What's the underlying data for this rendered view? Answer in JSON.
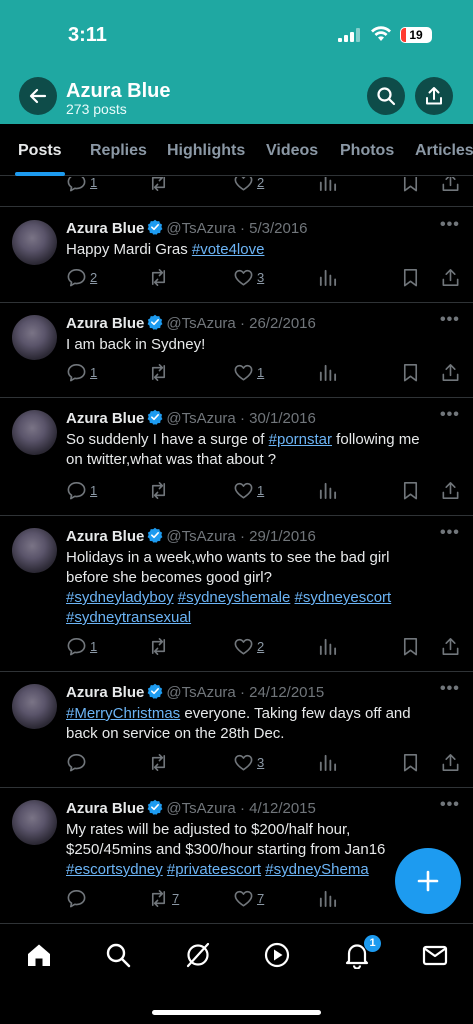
{
  "status_bar": {
    "time": "3:11",
    "battery": "19"
  },
  "header": {
    "name": "Azura Blue",
    "post_count": "273 posts"
  },
  "tabs": [
    {
      "label": "Posts",
      "active": true
    },
    {
      "label": "Replies"
    },
    {
      "label": "Highlights"
    },
    {
      "label": "Videos"
    },
    {
      "label": "Photos"
    },
    {
      "label": "Articles"
    }
  ],
  "partial_tweet": {
    "replies": "1",
    "likes": "2"
  },
  "tweets": [
    {
      "name": "Azura Blue",
      "handle": "@TsAzura",
      "date": "5/3/2016",
      "text_parts": [
        "Happy Mardi Gras "
      ],
      "tags": [
        "#vote4love"
      ],
      "replies": "2",
      "reposts": "",
      "likes": "3"
    },
    {
      "name": "Azura Blue",
      "handle": "@TsAzura",
      "date": "26/2/2016",
      "text": "I am back in Sydney!",
      "replies": "1",
      "reposts": "",
      "likes": "1"
    },
    {
      "name": "Azura Blue",
      "handle": "@TsAzura",
      "date": "30/1/2016",
      "text_a": "So suddenly I have a surge of ",
      "tag": "#pornstar",
      "text_b": " following me",
      "text_c": "on twitter,what was that about ?",
      "replies": "1",
      "reposts": "",
      "likes": "1"
    },
    {
      "name": "Azura Blue",
      "handle": "@TsAzura",
      "date": "29/1/2016",
      "line1": "Holidays in a week,who wants to see the bad girl",
      "line2": "before she becomes good girl?",
      "tags": [
        "#sydneyladyboy",
        "#sydneyshemale",
        "#sydneyescort",
        "#sydneytransexual"
      ],
      "replies": "1",
      "reposts": "",
      "likes": "2"
    },
    {
      "name": "Azura Blue",
      "handle": "@TsAzura",
      "date": "24/12/2015",
      "tag": "#MerryChristmas",
      "text_a": " everyone. Taking few days off and",
      "text_b": "back on service on the 28th Dec.",
      "replies": "",
      "reposts": "",
      "likes": "3"
    },
    {
      "name": "Azura Blue",
      "handle": "@TsAzura",
      "date": "4/12/2015",
      "line1": "My rates will be adjusted to $200/half hour,",
      "line2": "$250/45mins and $300/hour starting from Jan16",
      "tags": [
        "#escortsydney",
        "#privateescort",
        "#sydneyShema"
      ],
      "replies": "",
      "reposts": "7",
      "likes": "7"
    }
  ],
  "bottom_nav": {
    "notification_count": "1"
  },
  "colors": {
    "header_teal": "#1fa8a2",
    "accent_blue": "#1d9bf0",
    "link_blue": "#6cb4f5"
  }
}
